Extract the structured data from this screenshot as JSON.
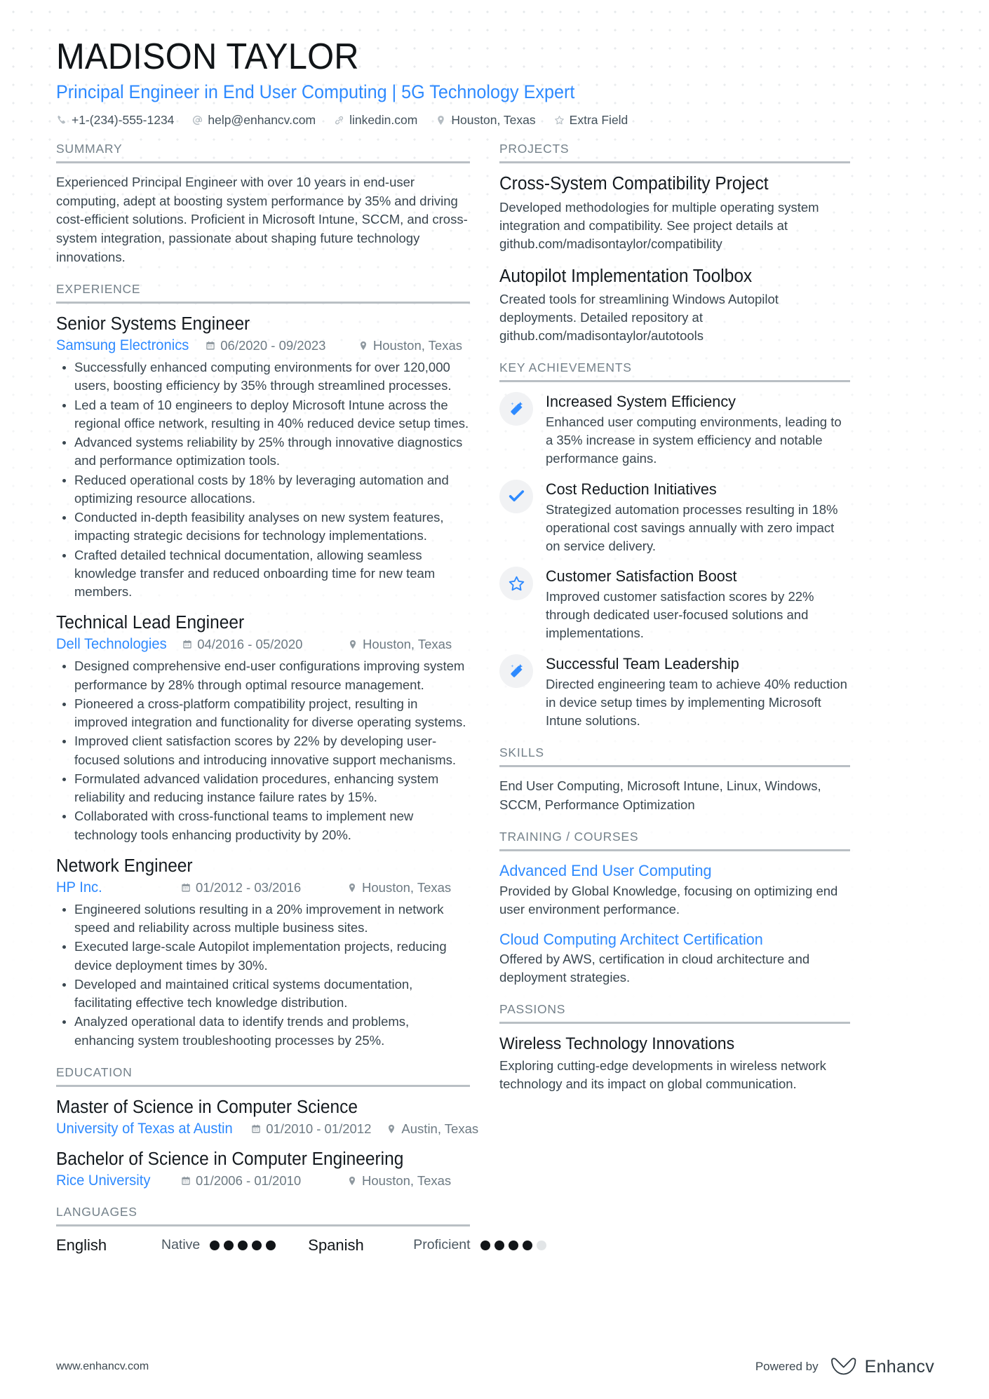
{
  "header": {
    "name": "MADISON TAYLOR",
    "headline": "Principal Engineer in End User Computing | 5G Technology Expert",
    "contacts": [
      {
        "icon": "phone-icon",
        "text": "+1-(234)-555-1234"
      },
      {
        "icon": "email-icon",
        "text": "help@enhancv.com"
      },
      {
        "icon": "link-icon",
        "text": "linkedin.com"
      },
      {
        "icon": "location-pin-icon",
        "text": "Houston, Texas"
      },
      {
        "icon": "star-icon",
        "text": "Extra Field"
      }
    ]
  },
  "left": {
    "summary": {
      "heading": "SUMMARY",
      "text": "Experienced Principal Engineer with over 10 years in end-user computing, adept at boosting system performance by 35% and driving cost-efficient solutions. Proficient in Microsoft Intune, SCCM, and cross-system integration, passionate about shaping future technology innovations."
    },
    "experience": {
      "heading": "EXPERIENCE",
      "entries": [
        {
          "title": "Senior Systems Engineer",
          "company": "Samsung Electronics",
          "dates": "06/2020 - 09/2023",
          "location": "Houston, Texas",
          "bullets": [
            "Successfully enhanced computing environments for over 120,000 users, boosting efficiency by 35% through streamlined processes.",
            "Led a team of 10 engineers to deploy Microsoft Intune across the regional office network, resulting in 40% reduced device setup times.",
            "Advanced systems reliability by 25% through innovative diagnostics and performance optimization tools.",
            "Reduced operational costs by 18% by leveraging automation and optimizing resource allocations.",
            "Conducted in-depth feasibility analyses on new system features, impacting strategic decisions for technology implementations.",
            "Crafted detailed technical documentation, allowing seamless knowledge transfer and reduced onboarding time for new team members."
          ]
        },
        {
          "title": "Technical Lead Engineer",
          "company": "Dell Technologies",
          "dates": "04/2016 - 05/2020",
          "location": "Houston, Texas",
          "bullets": [
            "Designed comprehensive end-user configurations improving system performance by 28% through optimal resource management.",
            "Pioneered a cross-platform compatibility project, resulting in improved integration and functionality for diverse operating systems.",
            "Improved client satisfaction scores by 22% by developing user-focused solutions and introducing innovative support mechanisms.",
            "Formulated advanced validation procedures, enhancing system reliability and reducing instance failure rates by 15%.",
            "Collaborated with cross-functional teams to implement new technology tools enhancing productivity by 20%."
          ]
        },
        {
          "title": "Network Engineer",
          "company": "HP Inc.",
          "dates": "01/2012 - 03/2016",
          "location": "Houston, Texas",
          "bullets": [
            "Engineered solutions resulting in a 20% improvement in network speed and reliability across multiple business sites.",
            "Executed large-scale Autopilot implementation projects, reducing device deployment times by 30%.",
            "Developed and maintained critical systems documentation, facilitating effective tech knowledge distribution.",
            "Analyzed operational data to identify trends and problems, enhancing system troubleshooting processes by 25%."
          ]
        }
      ]
    },
    "education": {
      "heading": "EDUCATION",
      "entries": [
        {
          "title": "Master of Science in Computer Science",
          "school": "University of Texas at Austin",
          "dates": "01/2010 - 01/2012",
          "location": "Austin, Texas"
        },
        {
          "title": "Bachelor of Science in Computer Engineering",
          "school": "Rice University",
          "dates": "01/2006 - 01/2010",
          "location": "Houston, Texas"
        }
      ]
    },
    "languages": {
      "heading": "LANGUAGES",
      "items": [
        {
          "name": "English",
          "level": "Native",
          "filled": 5,
          "total": 5
        },
        {
          "name": "Spanish",
          "level": "Proficient",
          "filled": 4,
          "total": 5
        }
      ]
    }
  },
  "right": {
    "projects": {
      "heading": "PROJECTS",
      "items": [
        {
          "title": "Cross-System Compatibility Project",
          "description": "Developed methodologies for multiple operating system integration and compatibility. See project details at github.com/madisontaylor/compatibility"
        },
        {
          "title": "Autopilot Implementation Toolbox",
          "description": "Created tools for streamlining Windows Autopilot deployments. Detailed repository at github.com/madisontaylor/autotools"
        }
      ]
    },
    "key_achievements": {
      "heading": "KEY ACHIEVEMENTS",
      "items": [
        {
          "icon": "magic-wand-icon",
          "title": "Increased System Efficiency",
          "description": "Enhanced user computing environments, leading to a 35% increase in system efficiency and notable performance gains."
        },
        {
          "icon": "check-icon",
          "title": "Cost Reduction Initiatives",
          "description": "Strategized automation processes resulting in 18% operational cost savings annually with zero impact on service delivery."
        },
        {
          "icon": "star-outline-icon",
          "title": "Customer Satisfaction Boost",
          "description": "Improved customer satisfaction scores by 22% through dedicated user-focused solutions and implementations."
        },
        {
          "icon": "magic-wand-icon",
          "title": "Successful Team Leadership",
          "description": "Directed engineering team to achieve 40% reduction in device setup times by implementing Microsoft Intune solutions."
        }
      ]
    },
    "skills": {
      "heading": "SKILLS",
      "text": "End User Computing, Microsoft Intune, Linux, Windows, SCCM, Performance Optimization"
    },
    "training": {
      "heading": "TRAINING / COURSES",
      "items": [
        {
          "title": "Advanced End User Computing",
          "description": "Provided by Global Knowledge, focusing on optimizing end user environment performance."
        },
        {
          "title": "Cloud Computing Architect Certification",
          "description": "Offered by AWS, certification in cloud architecture and deployment strategies."
        }
      ]
    },
    "passions": {
      "heading": "PASSIONS",
      "items": [
        {
          "title": "Wireless Technology Innovations",
          "description": "Exploring cutting-edge developments in wireless network technology and its impact on global communication."
        }
      ]
    }
  },
  "footer": {
    "url": "www.enhancv.com",
    "powered_by": "Powered by",
    "brand": "Enhancv"
  },
  "colors": {
    "accent": "#2e8aff",
    "text": "#39464f",
    "heading": "#74818a",
    "rule": "#b9bfc4"
  }
}
